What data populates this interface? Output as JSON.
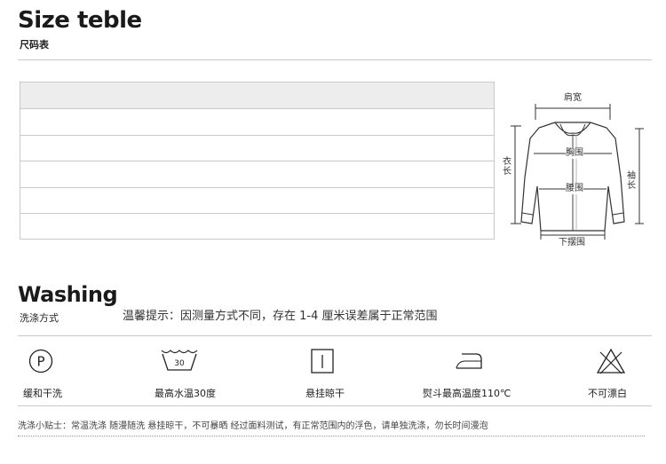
{
  "size_section": {
    "title": "Size teble",
    "subtitle": "尺码表"
  },
  "size_table": {
    "rows": 5
  },
  "diagram": {
    "shoulder": "肩宽",
    "chest": "胸围",
    "waist": "腰围",
    "length": "衣长",
    "sleeve": "袖长",
    "hem": "下摆围"
  },
  "washing_section": {
    "title": "Washing",
    "subtitle": "洗涤方式",
    "tip": "温馨提示：因测量方式不同，存在 1-4 厘米误差属于正常范围"
  },
  "care_items": [
    {
      "label": "缓和干洗",
      "icon": "dry-clean-p-icon"
    },
    {
      "label": "最高水温30度",
      "icon": "wash-30-icon",
      "temp": "30"
    },
    {
      "label": "悬挂晾干",
      "icon": "line-dry-icon"
    },
    {
      "label": "熨斗最高温度110℃",
      "icon": "iron-icon"
    },
    {
      "label": "不可漂白",
      "icon": "no-bleach-icon"
    }
  ],
  "note": "洗涤小贴士：常温洗涤 随漫随洗 悬挂晾干，不可暴晒 经过面料测试，有正常范围内的浮色，请单独洗涤，勿长时间漫泡"
}
